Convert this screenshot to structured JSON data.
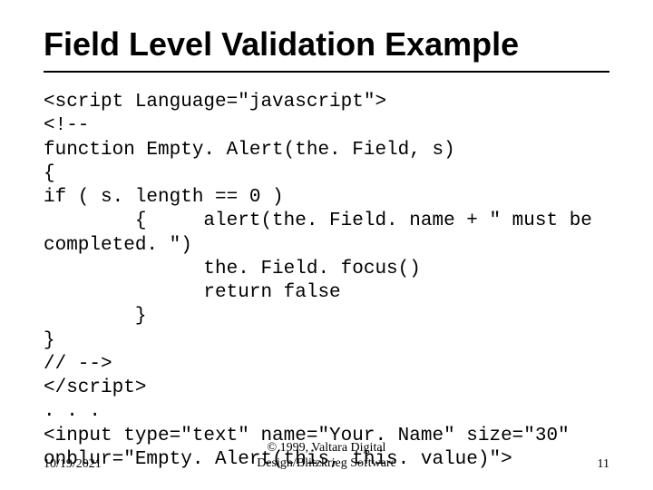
{
  "title": "Field Level Validation Example",
  "code": {
    "l1": "<script Language=\"javascript\">",
    "l2": "<!--",
    "l3": "function Empty. Alert(the. Field, s)",
    "l4": "{",
    "l5": "if ( s. length == 0 )",
    "l6": "        {     alert(the. Field. name + \" must be",
    "l7": "completed. \")",
    "l8": "              the. Field. focus()",
    "l9": "              return false",
    "l10": "        }",
    "l11": "}",
    "l12": "// -->",
    "l13": "</script>",
    "l14": ". . ."
  },
  "input_line": "<input type=\"text\" name=\"Your. Name\" size=\"30\" onblur=\"Empty. Alert(this, this. value)\">",
  "footer": {
    "date": "10/19/2021",
    "copyright_line1": "© 1999, Valtara Digital",
    "copyright_line2": "Design/Blitzkrieg Software",
    "page": "11"
  }
}
